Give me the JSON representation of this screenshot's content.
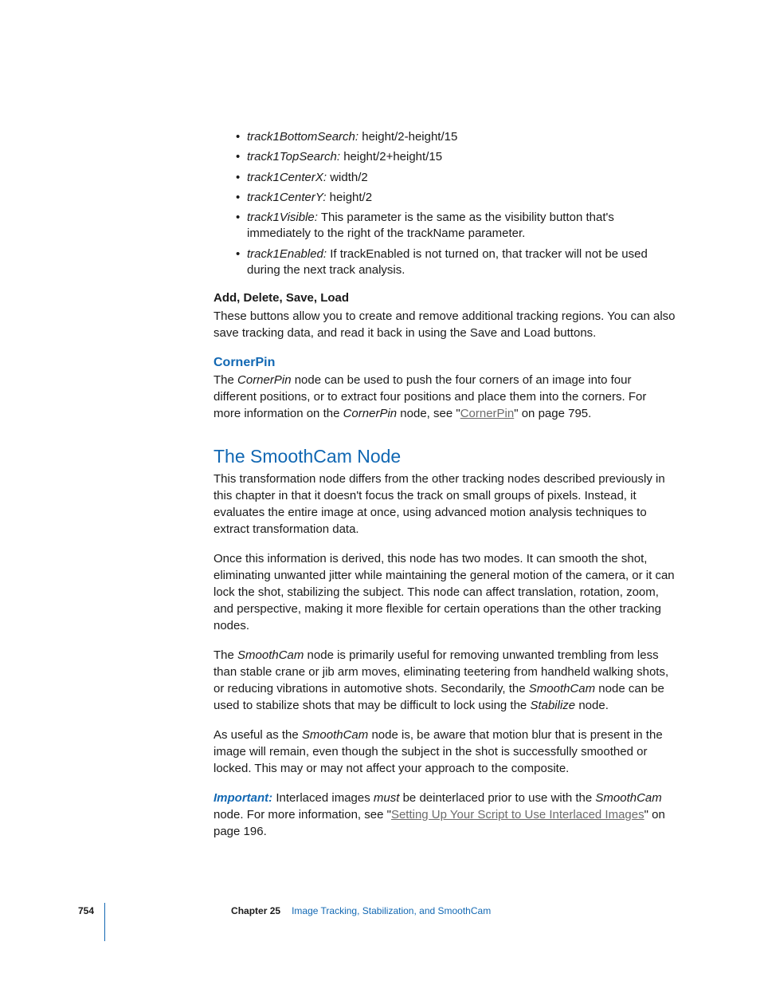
{
  "bullets": [
    {
      "term": "track1BottomSearch:",
      "desc": "height/2-height/15"
    },
    {
      "term": "track1TopSearch:",
      "desc": "height/2+height/15"
    },
    {
      "term": "track1CenterX:",
      "desc": "width/2"
    },
    {
      "term": "track1CenterY:",
      "desc": "height/2"
    },
    {
      "term": "track1Visible:",
      "desc": "This parameter is the same as the visibility button that's immediately to the right of the trackName parameter."
    },
    {
      "term": "track1Enabled:",
      "desc": "If trackEnabled is not turned on, that tracker will not be used during the next track analysis."
    }
  ],
  "add_heading": "Add, Delete, Save, Load",
  "add_body": "These buttons allow you to create and remove additional tracking regions. You can also save tracking data, and read it back in using the Save and Load buttons.",
  "cornerpin_heading": "CornerPin",
  "cornerpin_pre": "The ",
  "cornerpin_term": "CornerPin",
  "cornerpin_post1": " node can be used to push the four corners of an image into four different positions, or to extract four positions and place them into the corners. For more information on the ",
  "cornerpin_term2": "CornerPin",
  "cornerpin_post2": " node, see \"",
  "cornerpin_link": "CornerPin",
  "cornerpin_post3": "\" on page 795.",
  "smooth_heading": "The SmoothCam Node",
  "smooth_p1": "This transformation node differs from the other tracking nodes described previously in this chapter in that it doesn't focus the track on small groups of pixels. Instead, it evaluates the entire image at once, using advanced motion analysis techniques to extract transformation data.",
  "smooth_p2": "Once this information is derived, this node has two modes. It can smooth the shot, eliminating unwanted jitter while maintaining the general motion of the camera, or it can lock the shot, stabilizing the subject. This node can affect translation, rotation, zoom, and perspective, making it more flexible for certain operations than the other tracking nodes.",
  "smooth_p3_a": "The ",
  "smooth_p3_b": "SmoothCam",
  "smooth_p3_c": " node is primarily useful for removing unwanted trembling from less than stable crane or jib arm moves, eliminating teetering from handheld walking shots, or reducing vibrations in automotive shots. Secondarily, the ",
  "smooth_p3_d": "SmoothCam",
  "smooth_p3_e": " node can be used to stabilize shots that may be difficult to lock using the ",
  "smooth_p3_f": "Stabilize",
  "smooth_p3_g": " node.",
  "smooth_p4_a": "As useful as the ",
  "smooth_p4_b": "SmoothCam",
  "smooth_p4_c": " node is, be aware that motion blur that is present in the image will remain, even though the subject in the shot is successfully smoothed or locked. This may or may not affect your approach to the composite.",
  "imp_label": "Important:  ",
  "imp_a": "Interlaced images ",
  "imp_b": "must",
  "imp_c": " be deinterlaced prior to use with the ",
  "imp_d": "SmoothCam",
  "imp_e": " node. For more information, see \"",
  "imp_link": "Setting Up Your Script to Use Interlaced Images",
  "imp_f": "\" on page 196.",
  "footer": {
    "page": "754",
    "chapter_label": "Chapter 25",
    "chapter_title": "Image Tracking, Stabilization, and SmoothCam"
  }
}
